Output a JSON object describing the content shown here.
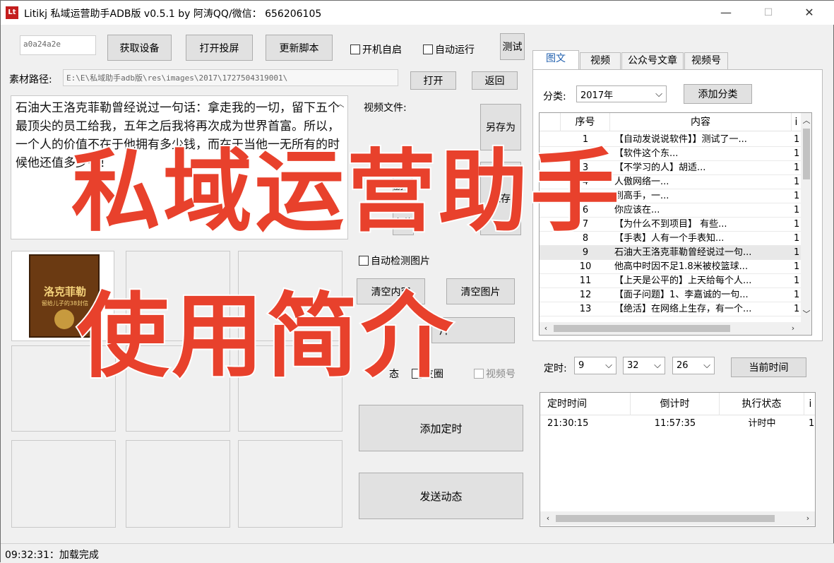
{
  "window": {
    "title": "Litikj 私域运营助手ADB版 v0.5.1 by 阿涛QQ/微信： 656206105",
    "app_icon": "Lt",
    "min": "—",
    "max": "☐",
    "close": "✕"
  },
  "toolbar": {
    "device_id": "a0a24a2e",
    "get_device": "获取设备",
    "open_mirror": "打开投屏",
    "update_script": "更新脚本",
    "autostart": "开机自启",
    "autorun": "自动运行",
    "test": "测试"
  },
  "material": {
    "label": "素材路径:",
    "path": "E:\\E\\私域助手adb版\\res\\images\\2017\\1727504319001\\",
    "open": "打开",
    "back": "返回"
  },
  "content_text": "石油大王洛克菲勒曾经说过一句话：拿走我的一切，留下五个最顶尖的员工给我，五年之后我将再次成为世界首富。所以，一个人的价值不在于他拥有多少钱，而在于当他一无所有的时候他还值多少钱！",
  "middle": {
    "video_file_label": "视频文件:",
    "save_as": "另存为",
    "save": "保存",
    "delete_partial": "删",
    "upload_partial": "上传",
    "auto_detect": "自动检测图片",
    "clear_content": "清空内容",
    "clear_images": "清空图片",
    "images_partial": "片",
    "dynamic_partial": "态",
    "moments_partial": "友圈",
    "video_account": "视频号",
    "add_timer": "添加定时",
    "send_dynamic": "发送动态"
  },
  "book": {
    "title": "洛克菲勒",
    "subtitle": "留给儿子的38封信"
  },
  "tabs": [
    "图文",
    "视频",
    "公众号文章",
    "视频号"
  ],
  "category": {
    "label": "分类:",
    "value": "2017年",
    "add": "添加分类"
  },
  "grid": {
    "headers": [
      "序号",
      "内容",
      "i"
    ],
    "rows": [
      {
        "no": "1",
        "content": "【自动发说说软件】】测试了一...",
        "i": "1"
      },
      {
        "no": "2",
        "content": "【软件这个东...",
        "i": "1"
      },
      {
        "no": "3",
        "content": "【不学习的人】胡适...",
        "i": "1"
      },
      {
        "no": "4",
        "content": "人傲网络一...",
        "i": "1"
      },
      {
        "no": "5",
        "content": "到高手，一...",
        "i": "1"
      },
      {
        "no": "6",
        "content": "你应该在...",
        "i": "1"
      },
      {
        "no": "7",
        "content": "【为什么不到项目】 有些...",
        "i": "1"
      },
      {
        "no": "8",
        "content": "【手表】人有一个手表知...",
        "i": "1"
      },
      {
        "no": "9",
        "content": "石油大王洛克菲勒曾经说过一句...",
        "i": "1"
      },
      {
        "no": "10",
        "content": "他高中时因不足1.8米被校篮球...",
        "i": "1"
      },
      {
        "no": "11",
        "content": "【上天是公平的】上天给每个人...",
        "i": "1"
      },
      {
        "no": "12",
        "content": "【面子问题】1、李嘉诚的一句...",
        "i": "1"
      },
      {
        "no": "13",
        "content": "【绝活】在网络上生存，有一个...",
        "i": "1"
      }
    ]
  },
  "timer": {
    "label": "定时:",
    "hour": "9",
    "minute": "32",
    "second": "26",
    "current_time": "当前时间"
  },
  "schedule": {
    "headers": [
      "定时时间",
      "倒计时",
      "执行状态",
      "i"
    ],
    "rows": [
      {
        "time": "21:30:15",
        "countdown": "11:57:35",
        "status": "计时中",
        "i": "1"
      }
    ]
  },
  "status": "09:32:31：加载完成",
  "overlay": {
    "line1": "私域运营助手",
    "line2": "使用简介"
  },
  "colors": {
    "overlay_red": "#e8412c",
    "tab_active_text": "#1f5fae"
  }
}
